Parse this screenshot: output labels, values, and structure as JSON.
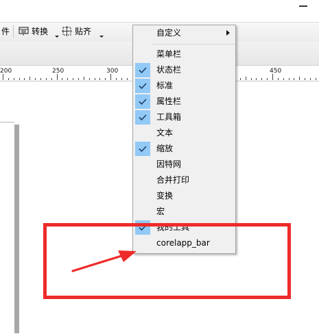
{
  "window": {
    "minimize_glyph": "−"
  },
  "toolbar": {
    "partial_item_label": "件",
    "transform_label": "转换",
    "snap_label": "贴齐"
  },
  "ruler": {
    "labels": [
      "200",
      "250",
      "300",
      "450"
    ]
  },
  "context_menu": {
    "items": [
      {
        "label": "自定义",
        "checked": false,
        "has_submenu": true
      },
      {
        "label": "菜单栏",
        "checked": false
      },
      {
        "label": "状态栏",
        "checked": true
      },
      {
        "label": "标准",
        "checked": true
      },
      {
        "label": "属性栏",
        "checked": true
      },
      {
        "label": "工具箱",
        "checked": true
      },
      {
        "label": "文本",
        "checked": false
      },
      {
        "label": "缩放",
        "checked": true
      },
      {
        "label": "因特网",
        "checked": false
      },
      {
        "label": "合并打印",
        "checked": false
      },
      {
        "label": "变换",
        "checked": false
      },
      {
        "label": "宏",
        "checked": false
      },
      {
        "label": "我的工具",
        "checked": true
      },
      {
        "label": "corelapp_bar",
        "checked": false
      }
    ]
  },
  "colors": {
    "annotation_red": "#ee2a2a",
    "check_highlight": "#91c9f7",
    "menu_background": "#f0f0f0"
  }
}
